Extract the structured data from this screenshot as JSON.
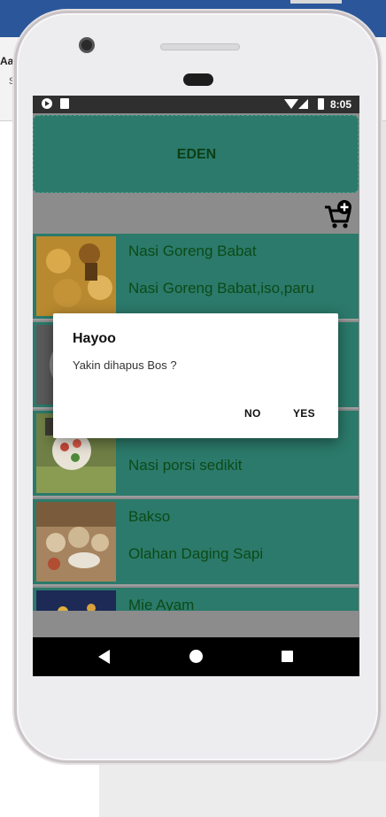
{
  "background": {
    "ribbon_text": "Aal",
    "ribbon_text2": "S"
  },
  "statusbar": {
    "time": "8:05"
  },
  "app": {
    "title": "EDEN",
    "accent_color": "#2b7a6b",
    "text_color": "#0c4a17"
  },
  "items": [
    {
      "name": "Nasi Goreng Babat",
      "desc": "Nasi Goreng Babat,iso,paru"
    },
    {
      "name": "",
      "desc": ""
    },
    {
      "name": "",
      "desc": "Nasi porsi sedikit"
    },
    {
      "name": "Bakso",
      "desc": "Olahan Daging Sapi"
    },
    {
      "name": "Mie Ayam",
      "desc": ""
    }
  ],
  "dialog": {
    "title": "Hayoo",
    "message": "Yakin dihapus Bos ?",
    "no_label": "NO",
    "yes_label": "YES"
  },
  "icons": {
    "cart": "cart-add-icon",
    "back": "nav-back-icon",
    "home": "nav-home-icon",
    "recent": "nav-recent-icon"
  }
}
